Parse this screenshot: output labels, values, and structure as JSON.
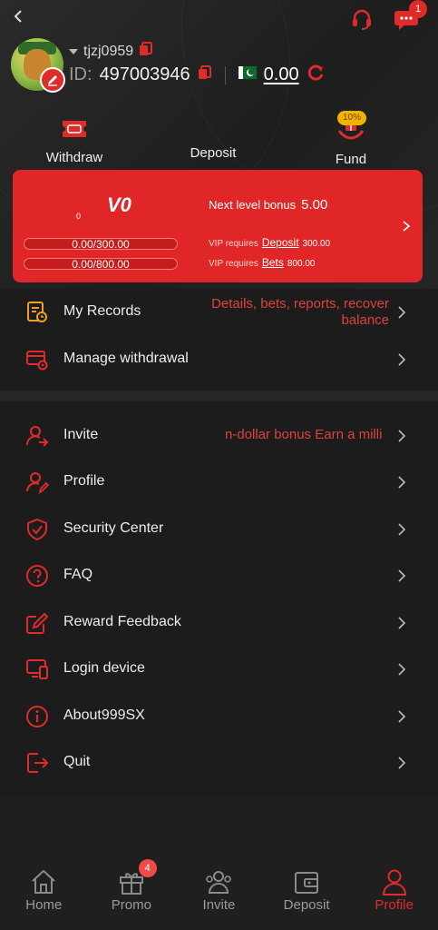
{
  "header": {
    "notification_count": "1"
  },
  "user": {
    "username": "tjzj0959",
    "id_label": "ID:",
    "id_value": "497003946",
    "balance": "0.00",
    "flag": "🇵🇰"
  },
  "quick_actions": [
    {
      "label": "Withdraw",
      "icon": "ticket-icon"
    },
    {
      "label": "Deposit",
      "icon": "wallet-icon"
    },
    {
      "label": "Fund",
      "icon": "gift-hands-icon",
      "badge": "10%"
    }
  ],
  "vip": {
    "level_mark": "0",
    "level": "V0",
    "deposit_progress": "0.00/300.00",
    "bets_progress": "0.00/800.00",
    "next_level_bonus_label": "Next level bonus",
    "next_level_bonus_value": "5.00",
    "req1_prefix": "VIP requires",
    "req1_link": "Deposit",
    "req1_value": "300.00",
    "req2_prefix": "VIP requires",
    "req2_link": "Bets",
    "req2_value": "800.00",
    "colors": {
      "card": "#e02626"
    }
  },
  "menu1": [
    {
      "label": "My Records",
      "note_line1": "Details, bets, reports, recover",
      "note_line2": "balance",
      "icon": "records-icon"
    },
    {
      "label": "Manage withdrawal",
      "icon": "withdrawal-settings-icon"
    }
  ],
  "menu2": [
    {
      "label": "Invite",
      "note": "n-dollar bonus  Earn a milli",
      "icon": "invite-user-icon"
    },
    {
      "label": "Profile",
      "icon": "profile-edit-icon"
    },
    {
      "label": "Security Center",
      "icon": "shield-icon"
    },
    {
      "label": "FAQ",
      "icon": "question-icon"
    },
    {
      "label": "Reward Feedback",
      "icon": "edit-note-icon"
    },
    {
      "label": "Login device",
      "icon": "devices-icon"
    },
    {
      "label": "About999SX",
      "icon": "info-icon"
    },
    {
      "label": "Quit",
      "icon": "logout-icon"
    }
  ],
  "bottom_nav": [
    {
      "label": "Home",
      "icon": "home-icon"
    },
    {
      "label": "Promo",
      "icon": "gift-icon",
      "badge": "4"
    },
    {
      "label": "Invite",
      "icon": "people-icon"
    },
    {
      "label": "Deposit",
      "icon": "wallet-icon"
    },
    {
      "label": "Profile",
      "icon": "person-icon",
      "active": true
    }
  ],
  "theme": {
    "accent": "#e02b2b",
    "background": "#1c1c1c"
  }
}
